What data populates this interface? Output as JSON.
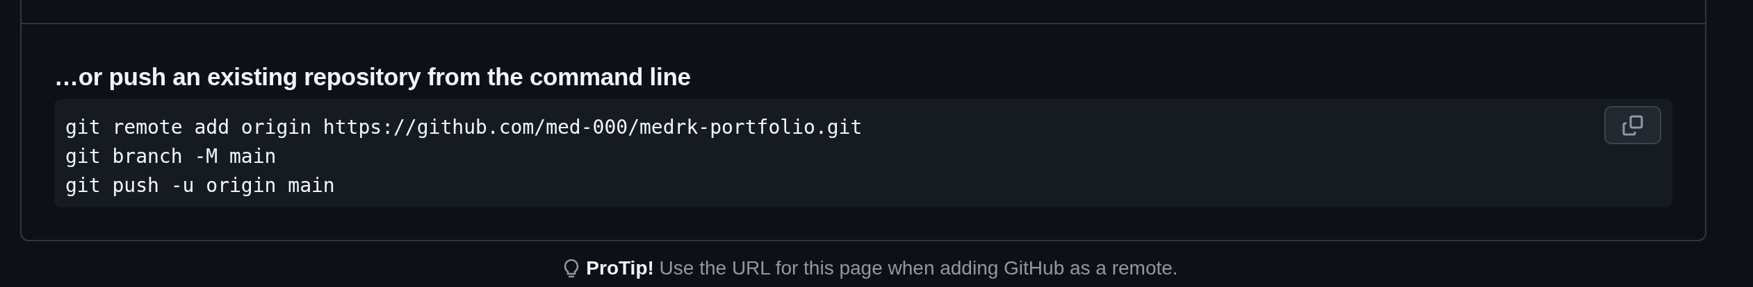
{
  "heading": "…or push an existing repository from the command line",
  "code_lines": [
    "git remote add origin https://github.com/med-000/medrk-portfolio.git",
    "git branch -M main",
    "git push -u origin main"
  ],
  "protip": "**ProTip!** Use the URL for this page when adding GitHub as a remote."
}
